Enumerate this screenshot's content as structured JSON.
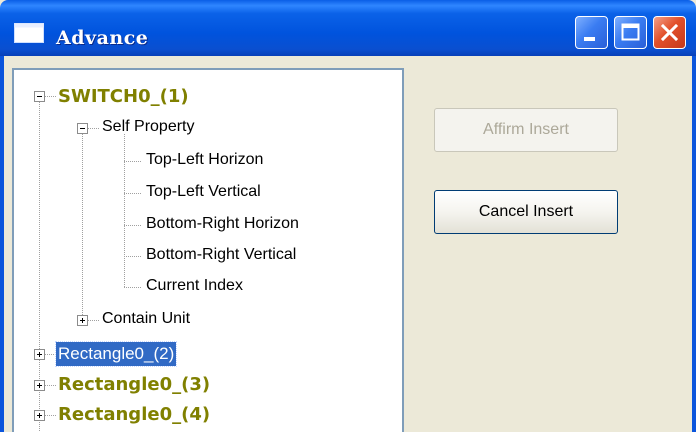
{
  "window": {
    "title": "Advance"
  },
  "titlebar_buttons": {
    "minimize_icon": "minimize-icon",
    "maximize_icon": "maximize-icon",
    "close_icon": "close-icon"
  },
  "tree": {
    "root1": "SWITCH0_(1)",
    "self_property": "Self Property",
    "props": [
      "Top-Left Horizon",
      "Top-Left Vertical",
      "Bottom-Right Horizon",
      "Bottom-Right Vertical",
      "Current Index"
    ],
    "contain_unit": "Contain Unit",
    "root2": "Rectangle0_(2)",
    "root3": "Rectangle0_(3)",
    "root4": "Rectangle0_(4)"
  },
  "buttons": {
    "affirm": "Affirm Insert",
    "affirm_enabled": false,
    "cancel": "Cancel Insert"
  },
  "colors": {
    "titlebar": "#0a56e0",
    "node_bold": "#808000",
    "selection": "#316ac5",
    "dialog_bg": "#ece9d8"
  }
}
